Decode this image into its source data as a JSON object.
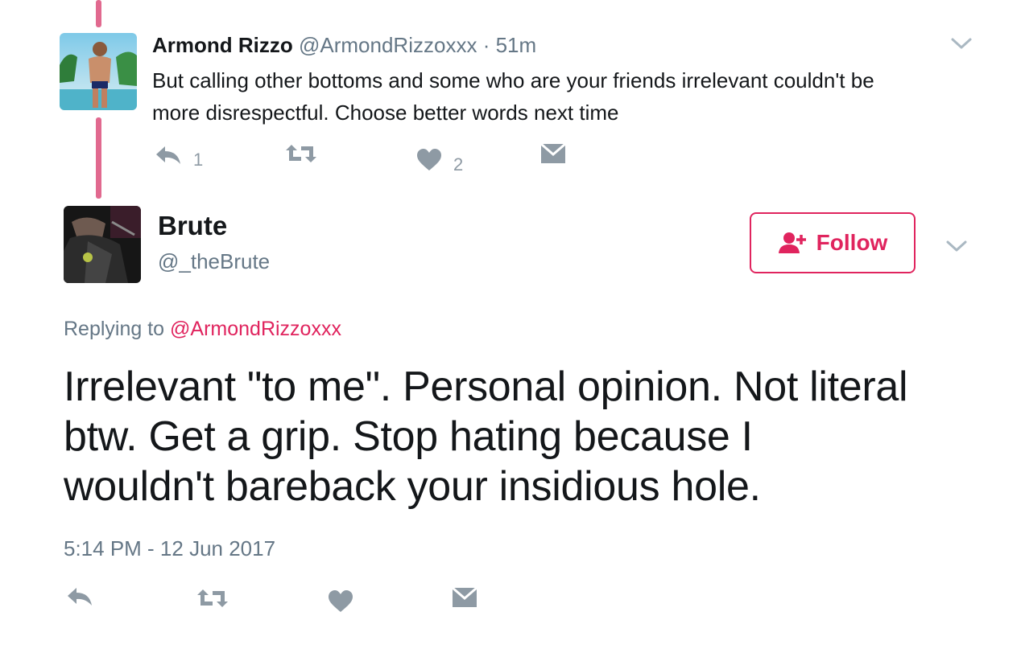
{
  "parent_tweet": {
    "name": "Armond Rizzo",
    "handle": "@ArmondRizzoxxx",
    "time": "· 51m",
    "text_line1": "But calling other bottoms and some who are your friends irrelevant couldn't be",
    "text_line2": "more disrespectful. Choose better words next time",
    "reply_count": "1",
    "like_count": "2",
    "icons": [
      "reply-icon",
      "retweet-icon",
      "heart-icon",
      "message-icon",
      "chevron-down-icon"
    ]
  },
  "main_tweet": {
    "name": "Brute",
    "handle": "@_theBrute",
    "follow_label": "Follow",
    "replying_prefix": "Replying to",
    "replying_handle": "@ArmondRizzoxxx",
    "text_line1": "Irrelevant \"to me\". Personal opinion. Not literal",
    "text_line2": "btw. Get a grip. Stop hating because I",
    "text_line3": "wouldn't bareback your insidious hole.",
    "timestamp": "5:14 PM - 12 Jun 2017",
    "icons": [
      "reply-icon",
      "retweet-icon",
      "heart-icon",
      "message-icon",
      "follow-user-icon",
      "chevron-down-icon"
    ]
  },
  "colors": {
    "accent": "#e0245e",
    "thread_line": "#e1698f",
    "muted": "#657786",
    "icon": "#8e9aa4"
  }
}
